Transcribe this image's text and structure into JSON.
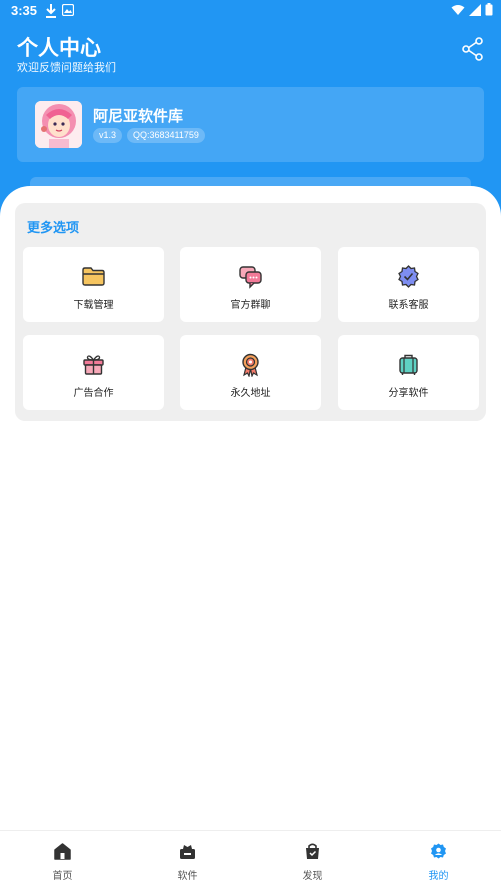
{
  "status_bar": {
    "time": "3:35"
  },
  "header": {
    "title": "个人中心",
    "subtitle": "欢迎反馈问题给我们"
  },
  "profile": {
    "app_name": "阿尼亚软件库",
    "version": "v1.3",
    "qq": "QQ:3683411759"
  },
  "options": {
    "title": "更多选项",
    "items": [
      {
        "label": "下载管理",
        "icon": "folder-icon"
      },
      {
        "label": "官方群聊",
        "icon": "chat-icon"
      },
      {
        "label": "联系客服",
        "icon": "verified-badge-icon"
      },
      {
        "label": "广告合作",
        "icon": "gift-icon"
      },
      {
        "label": "永久地址",
        "icon": "medal-icon"
      },
      {
        "label": "分享软件",
        "icon": "suitcase-icon"
      }
    ]
  },
  "bottom_nav": {
    "items": [
      {
        "label": "首页",
        "icon": "home-icon"
      },
      {
        "label": "软件",
        "icon": "apps-icon"
      },
      {
        "label": "发现",
        "icon": "bag-icon"
      },
      {
        "label": "我的",
        "icon": "profile-icon"
      }
    ],
    "active_index": 3
  },
  "colors": {
    "primary": "#2196f3",
    "panel_bg": "#efefef",
    "tile_bg": "#ffffff"
  }
}
